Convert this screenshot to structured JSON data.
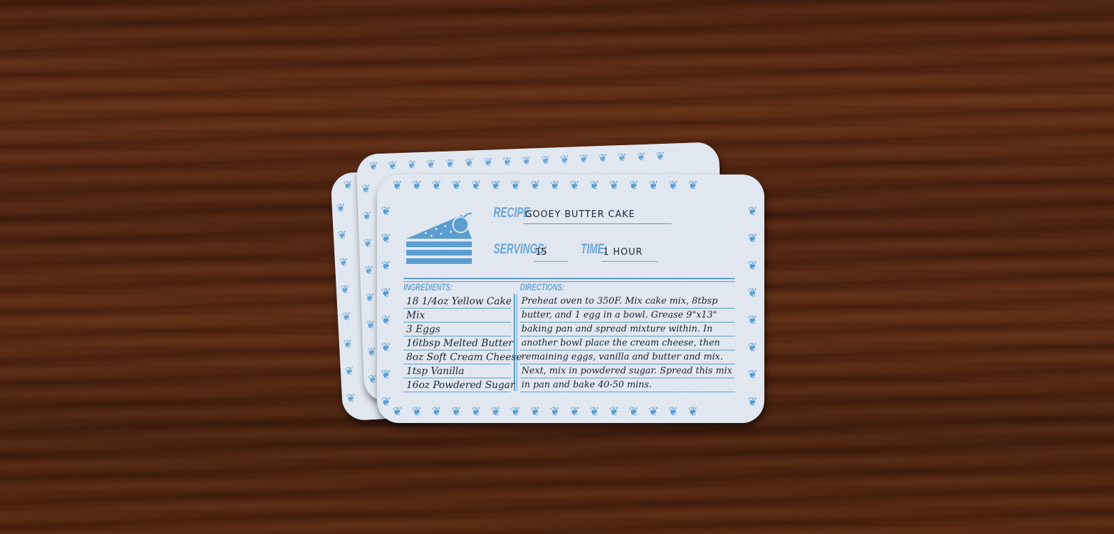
{
  "card": {
    "recipe_label": "RECIPE:",
    "recipe_name": "GOOEY BUTTER CAKE",
    "servings_label": "SERVINGS:",
    "servings_value": "15",
    "time_label": "TIME:",
    "time_value": "1 HOUR",
    "ingredients_label": "INGREDIENTS:",
    "directions_label": "DIRECTIONS:",
    "ingredients": [
      "18 1/4oz Yellow Cake",
      "Mix",
      "3 Eggs",
      "16tbsp Melted Butter",
      "8oz Soft Cream Cheese",
      "1tsp Vanilla",
      "16oz Powdered Sugar"
    ],
    "directions": [
      "Preheat oven to 350F. Mix cake mix, 8tbsp",
      "butter, and 1 egg in a bowl. Grease 9\"x13\"",
      "baking pan and spread mixture within. In",
      "another bowl place the cream cheese, then",
      "remaining eggs, vanilla and butter and mix.",
      "Next, mix in powdered sugar. Spread this mix",
      "in pan and bake 40-50 mins."
    ]
  },
  "colors": {
    "ink": "#1e2230",
    "accent": "#5b9ecf",
    "card": "#dfe6ef",
    "wood": "#4f2411"
  },
  "icons": {
    "header": "cake-slice-icon",
    "border": "flourish-border-icon"
  }
}
